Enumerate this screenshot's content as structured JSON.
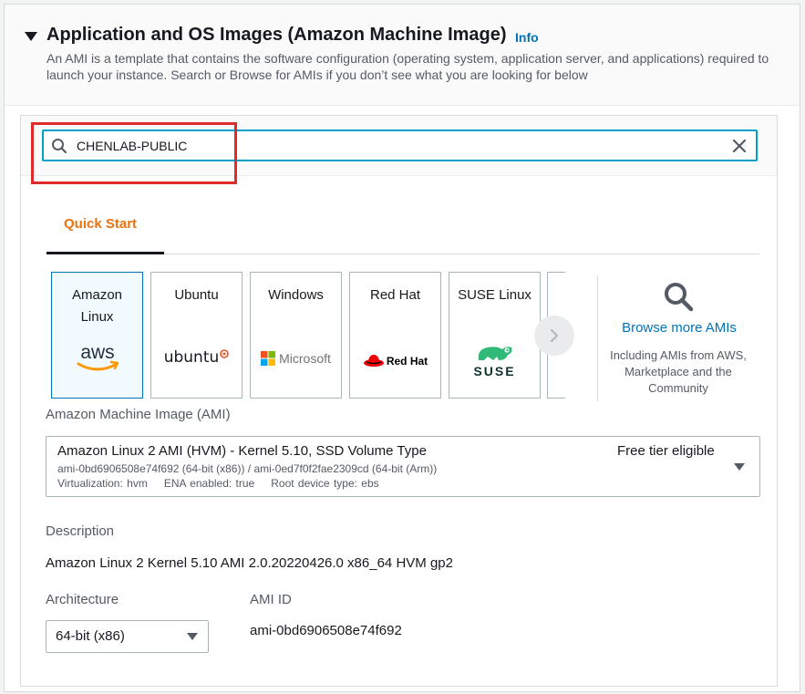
{
  "section": {
    "title": "Application and OS Images (Amazon Machine Image)",
    "info_link": "Info",
    "description": "An AMI is a template that contains the software configuration (operating system, application server, and applications) required to launch your instance. Search or Browse for AMIs if you don’t see what you are looking for below"
  },
  "search": {
    "value": "CHENLAB-PUBLIC",
    "icon": "search-icon",
    "clear_icon": "close-icon"
  },
  "tabs": [
    {
      "label": "Quick Start",
      "active": true
    }
  ],
  "os_cards": [
    {
      "line1": "Amazon",
      "line2": "Linux",
      "logo": "aws",
      "selected": true
    },
    {
      "line1": "Ubuntu",
      "line2": "",
      "logo": "ubuntu",
      "selected": false
    },
    {
      "line1": "Windows",
      "line2": "",
      "logo": "Microsoft",
      "selected": false
    },
    {
      "line1": "Red Hat",
      "line2": "",
      "logo": "Red Hat",
      "selected": false
    },
    {
      "line1": "SUSE Linux",
      "line2": "",
      "logo": "SUSE",
      "selected": false
    }
  ],
  "browse": {
    "icon": "search-icon",
    "link": "Browse more AMIs",
    "subtext": "Including AMIs from AWS, Marketplace and the Community"
  },
  "ami": {
    "label": "Amazon Machine Image (AMI)",
    "name": "Amazon Linux 2 AMI (HVM) - Kernel 5.10, SSD Volume Type",
    "ids": "ami-0bd6906508e74f692 (64-bit (x86)) / ami-0ed7f0f2fae2309cd (64-bit (Arm))",
    "virtualization": "Virtualization: hvm",
    "ena": "ENA enabled: true",
    "root_device": "Root device type: ebs",
    "badge": "Free tier eligible"
  },
  "details": {
    "description_label": "Description",
    "description_value": "Amazon Linux 2 Kernel 5.10 AMI 2.0.20220426.0 x86_64 HVM gp2",
    "architecture_label": "Architecture",
    "architecture_value": "64-bit (x86)",
    "ami_id_label": "AMI ID",
    "ami_id_value": "ami-0bd6906508e74f692"
  },
  "colors": {
    "accent_orange": "#ec7211",
    "link_blue": "#0073bb",
    "focus_border": "#00a1c9",
    "highlight_red": "#e02b2b"
  }
}
